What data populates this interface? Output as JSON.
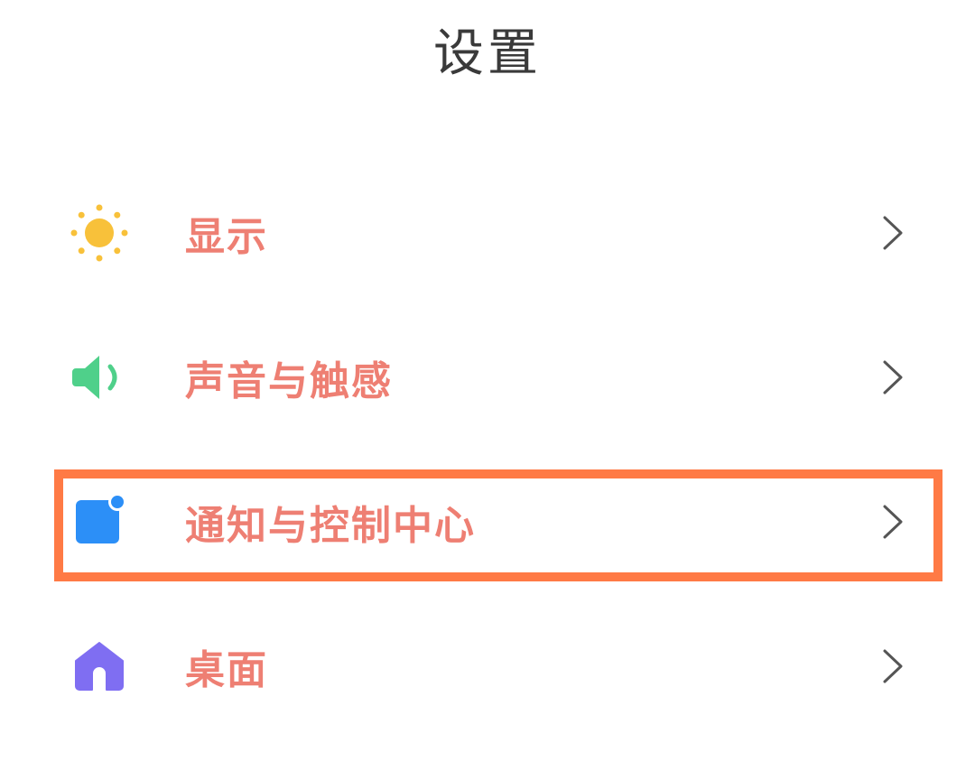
{
  "header": {
    "title": "设置"
  },
  "settings": {
    "items": [
      {
        "label": "显示",
        "icon": "sun-icon",
        "icon_color": "#f8c13a"
      },
      {
        "label": "声音与触感",
        "icon": "speaker-icon",
        "icon_color": "#4fd08a"
      },
      {
        "label": "通知与控制中心",
        "icon": "notification-icon",
        "icon_color": "#2c8ff7"
      },
      {
        "label": "桌面",
        "icon": "home-icon",
        "icon_color": "#7f6ef2"
      }
    ]
  },
  "colors": {
    "label": "#ee7f73",
    "title": "#3a3a3a",
    "chevron": "#555555",
    "highlight_border": "#ff7a45"
  }
}
